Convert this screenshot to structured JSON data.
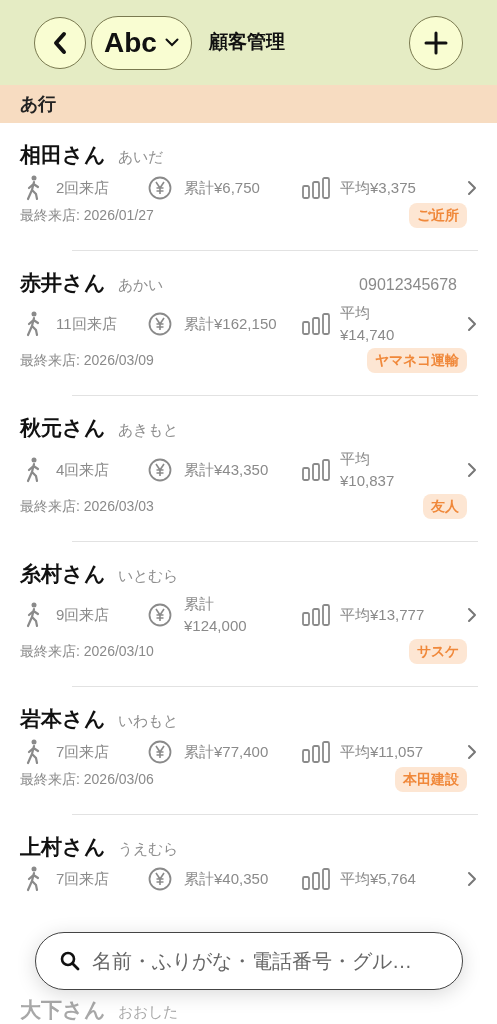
{
  "header": {
    "sort_label": "Abc",
    "title": "顧客管理"
  },
  "section": {
    "title": "あ行"
  },
  "customers": [
    {
      "name": "相田さん",
      "kana": "あいだ",
      "visits": "2回来店",
      "total": "累計¥6,750",
      "average": "平均¥3,375",
      "last_visit": "最終来店: 2026/01/27",
      "tag": "ご近所"
    },
    {
      "name": "赤井さん",
      "kana": "あかい",
      "phone": "09012345678",
      "visits": "11回来店",
      "total": "累計¥162,150",
      "average": "平均\n¥14,740",
      "last_visit": "最終来店: 2026/03/09",
      "tag": "ヤマネコ運輸"
    },
    {
      "name": "秋元さん",
      "kana": "あきもと",
      "visits": "4回来店",
      "total": "累計¥43,350",
      "average": "平均\n¥10,837",
      "last_visit": "最終来店: 2026/03/03",
      "tag": "友人"
    },
    {
      "name": "糸村さん",
      "kana": "いとむら",
      "visits": "9回来店",
      "total": "累計\n¥124,000",
      "average": "平均¥13,777",
      "last_visit": "最終来店: 2026/03/10",
      "tag": "サスケ"
    },
    {
      "name": "岩本さん",
      "kana": "いわもと",
      "visits": "7回来店",
      "total": "累計¥77,400",
      "average": "平均¥11,057",
      "last_visit": "最終来店: 2026/03/06",
      "tag": "本田建設"
    },
    {
      "name": "上村さん",
      "kana": "うえむら",
      "visits": "7回来店",
      "total": "累計¥40,350",
      "average": "平均¥5,764"
    }
  ],
  "faded_customer": {
    "name": "大下さん",
    "kana": "おおした"
  },
  "search": {
    "placeholder": "名前・ふりがな・電話番号・グル…"
  }
}
